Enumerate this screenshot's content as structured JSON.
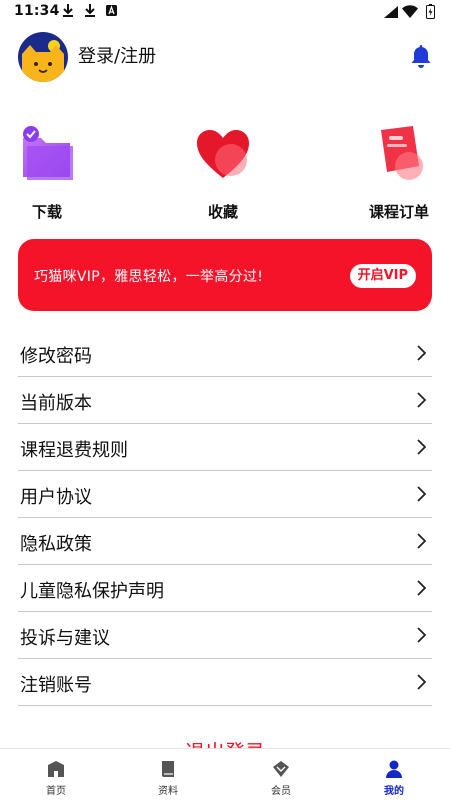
{
  "status_bar": {
    "time": "11:34"
  },
  "header": {
    "login_label": "登录/注册"
  },
  "quick_entries": [
    {
      "label": "下载",
      "icon": "download-folder-icon"
    },
    {
      "label": "收藏",
      "icon": "heart-icon"
    },
    {
      "label": "课程订单",
      "icon": "order-clipboard-icon"
    }
  ],
  "vip_banner": {
    "text": "巧猫咪VIP，雅思轻松，一举高分过!",
    "button_label": "开启VIP"
  },
  "settings": [
    "修改密码",
    "当前版本",
    "课程退费规则",
    "用户协议",
    "隐私政策",
    "儿童隐私保护声明",
    "投诉与建议",
    "注销账号"
  ],
  "logout_label": "退出登录",
  "bottom_nav": [
    {
      "label": "首页",
      "icon": "home-icon"
    },
    {
      "label": "资料",
      "icon": "book-icon"
    },
    {
      "label": "会员",
      "icon": "diamond-icon"
    },
    {
      "label": "我的",
      "icon": "person-icon",
      "active": true
    }
  ],
  "colors": {
    "accent_red": "#f5132a",
    "nav_active": "#1427c9"
  }
}
